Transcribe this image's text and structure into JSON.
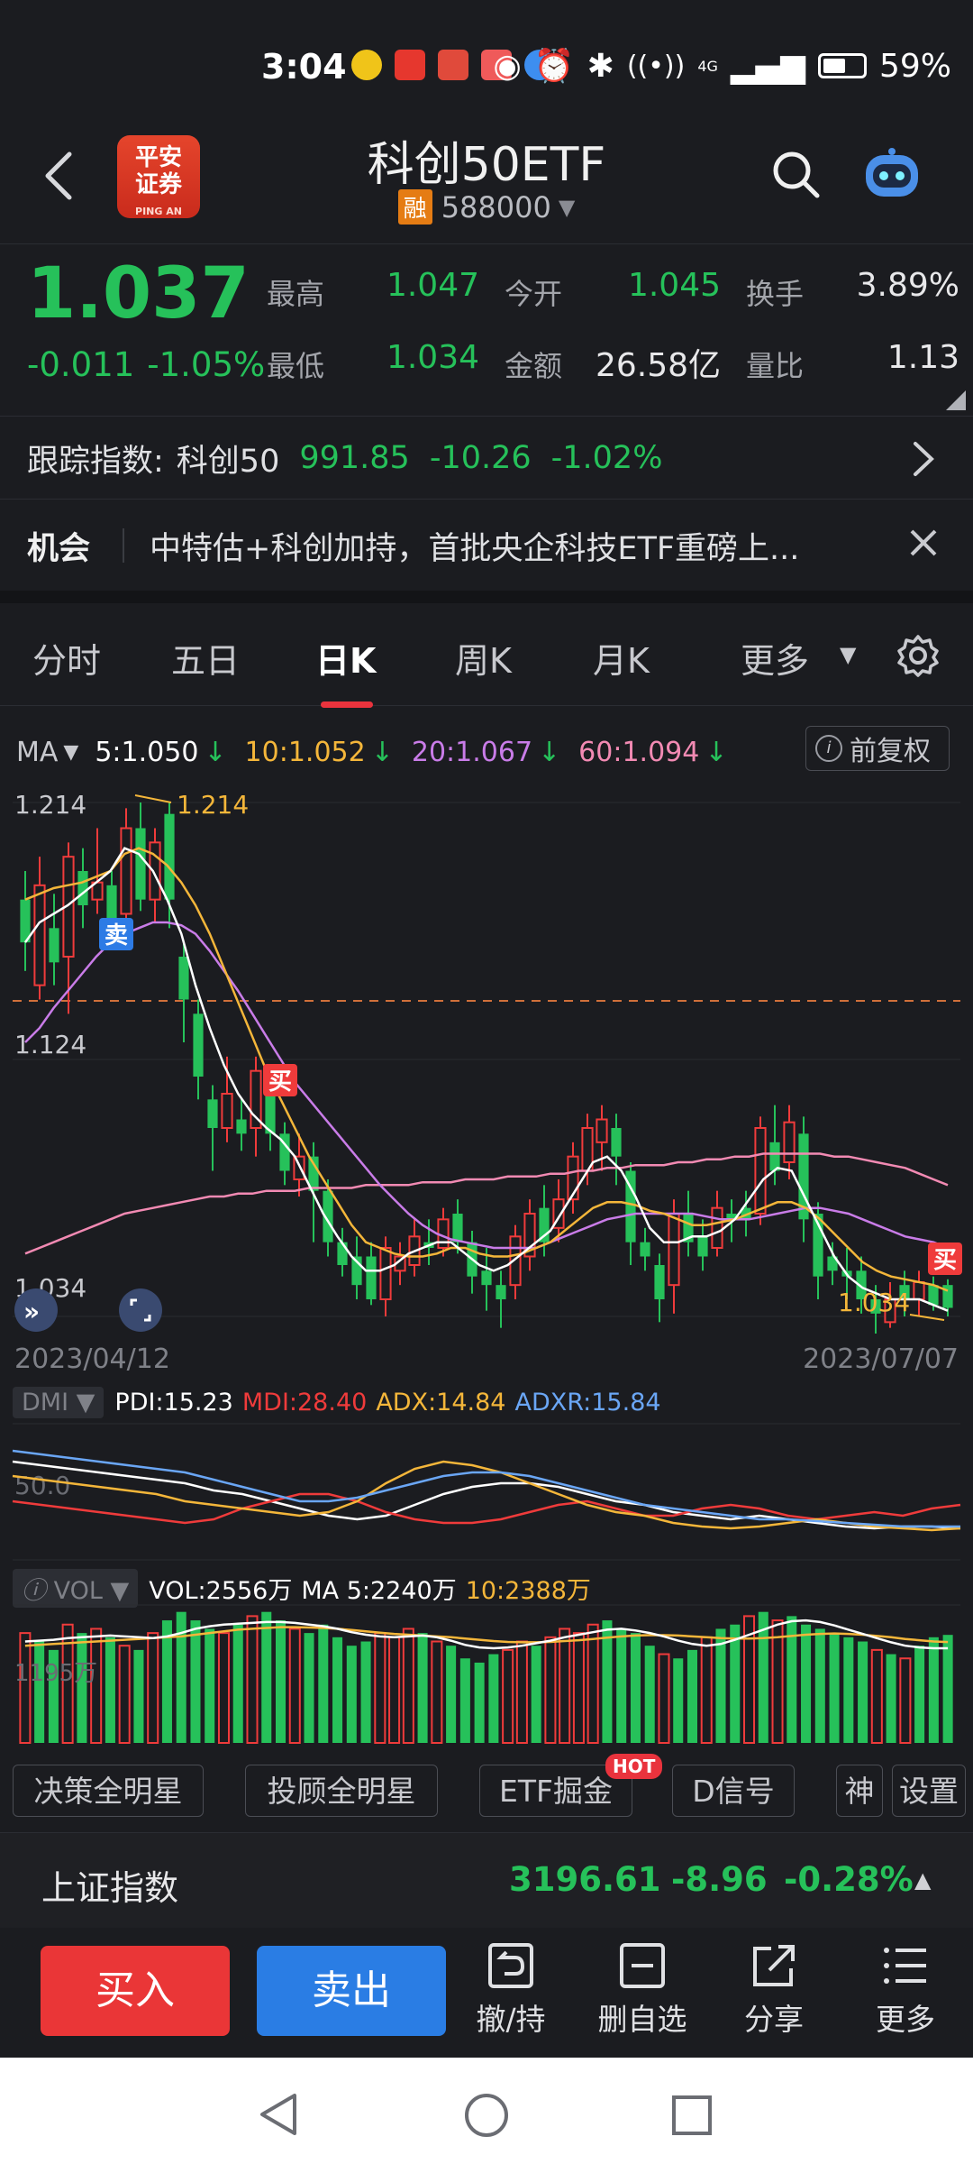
{
  "status_bar": {
    "time": "3:04",
    "battery": "59%",
    "network": "4G"
  },
  "header": {
    "title": "科创50ETF",
    "margin_badge": "融",
    "code": "588000",
    "logo_text_1": "平安",
    "logo_text_2": "证券",
    "logo_sub": "PING AN"
  },
  "quote": {
    "price": "1.037",
    "change": "-0.011",
    "change_pct": "-1.05%",
    "high_label": "最高",
    "high": "1.047",
    "open_label": "今开",
    "open": "1.045",
    "turnover_label": "换手",
    "turnover": "3.89%",
    "low_label": "最低",
    "low": "1.034",
    "amount_label": "金额",
    "amount": "26.58亿",
    "vol_ratio_label": "量比",
    "vol_ratio": "1.13"
  },
  "tracking": {
    "label": "跟踪指数:",
    "name": "科创50",
    "value": "991.85",
    "change": "-10.26",
    "pct": "-1.02%"
  },
  "news": {
    "tag": "机会",
    "text": "中特估+科创加持，首批央企科技ETF重磅上..."
  },
  "tabs": [
    "分时",
    "五日",
    "日K",
    "周K",
    "月K",
    "更多"
  ],
  "ma": {
    "label": "MA",
    "ma5": "5:1.050",
    "ma10": "10:1.052",
    "ma20": "20:1.067",
    "ma60": "60:1.094",
    "fuquan": "前复权"
  },
  "chart_labels": {
    "y_top": "1.214",
    "y_mid": "1.124",
    "y_bottom": "1.034",
    "max_mark": "1.214",
    "min_mark": "1.034",
    "sell_badge": "卖",
    "buy_badge": "买",
    "buy_badge2": "买"
  },
  "dates": {
    "start": "2023/04/12",
    "end": "2023/07/07"
  },
  "dmi": {
    "pill": "DMI",
    "pdi": "PDI:15.23",
    "mdi": "MDI:28.40",
    "adx": "ADX:14.84",
    "adxr": "ADXR:15.84",
    "axis": "50.0"
  },
  "vol": {
    "pill": "VOL",
    "vol": "VOL:2556万",
    "ma5": "MA 5:2240万",
    "ma10": "10:2388万",
    "axis": "1195万"
  },
  "chips": [
    "决策全明星",
    "投顾全明星",
    "ETF掘金",
    "D信号",
    "神",
    "设置"
  ],
  "chip_hot": "HOT",
  "index_bar": {
    "name": "上证指数",
    "value": "3196.61",
    "change": "-8.96",
    "pct": "-0.28%"
  },
  "actions": {
    "buy": "买入",
    "sell": "卖出",
    "cancel": "撤/持",
    "remove": "删自选",
    "share": "分享",
    "more": "更多"
  },
  "colors": {
    "up": "#ef3b3b",
    "down": "#26c15a",
    "ma5": "#ffffff",
    "ma10": "#f4b63a",
    "ma20": "#c97ce8",
    "ma60": "#f28ab3",
    "buy": "#ef3b3b",
    "sell": "#2d7be5"
  },
  "chart_data": [
    {
      "type": "candlestick",
      "x_range": [
        "2023/04/12",
        "2023/07/07"
      ],
      "ylim": [
        1.034,
        1.214
      ],
      "max": 1.214,
      "min": 1.034,
      "candles": [
        {
          "o": 1.18,
          "c": 1.165,
          "h": 1.19,
          "l": 1.155
        },
        {
          "o": 1.15,
          "c": 1.185,
          "h": 1.195,
          "l": 1.145
        },
        {
          "o": 1.17,
          "c": 1.158,
          "h": 1.182,
          "l": 1.15
        },
        {
          "o": 1.16,
          "c": 1.195,
          "h": 1.2,
          "l": 1.14
        },
        {
          "o": 1.19,
          "c": 1.178,
          "h": 1.198,
          "l": 1.17
        },
        {
          "o": 1.18,
          "c": 1.186,
          "h": 1.205,
          "l": 1.175
        },
        {
          "o": 1.185,
          "c": 1.172,
          "h": 1.19,
          "l": 1.165
        },
        {
          "o": 1.175,
          "c": 1.205,
          "h": 1.212,
          "l": 1.17
        },
        {
          "o": 1.205,
          "c": 1.18,
          "h": 1.214,
          "l": 1.176
        },
        {
          "o": 1.18,
          "c": 1.2,
          "h": 1.205,
          "l": 1.172
        },
        {
          "o": 1.21,
          "c": 1.18,
          "h": 1.214,
          "l": 1.17
        },
        {
          "o": 1.16,
          "c": 1.145,
          "h": 1.165,
          "l": 1.13
        },
        {
          "o": 1.14,
          "c": 1.118,
          "h": 1.145,
          "l": 1.11
        },
        {
          "o": 1.11,
          "c": 1.1,
          "h": 1.115,
          "l": 1.085
        },
        {
          "o": 1.1,
          "c": 1.112,
          "h": 1.125,
          "l": 1.095
        },
        {
          "o": 1.103,
          "c": 1.098,
          "h": 1.11,
          "l": 1.092
        },
        {
          "o": 1.1,
          "c": 1.12,
          "h": 1.125,
          "l": 1.09
        },
        {
          "o": 1.118,
          "c": 1.098,
          "h": 1.122,
          "l": 1.092
        },
        {
          "o": 1.098,
          "c": 1.085,
          "h": 1.102,
          "l": 1.08
        },
        {
          "o": 1.082,
          "c": 1.09,
          "h": 1.098,
          "l": 1.076
        },
        {
          "o": 1.09,
          "c": 1.078,
          "h": 1.095,
          "l": 1.06
        },
        {
          "o": 1.078,
          "c": 1.06,
          "h": 1.082,
          "l": 1.055
        },
        {
          "o": 1.06,
          "c": 1.052,
          "h": 1.065,
          "l": 1.048
        },
        {
          "o": 1.055,
          "c": 1.045,
          "h": 1.062,
          "l": 1.04
        },
        {
          "o": 1.055,
          "c": 1.04,
          "h": 1.06,
          "l": 1.038
        },
        {
          "o": 1.04,
          "c": 1.058,
          "h": 1.062,
          "l": 1.034
        },
        {
          "o": 1.05,
          "c": 1.055,
          "h": 1.06,
          "l": 1.045
        },
        {
          "o": 1.052,
          "c": 1.062,
          "h": 1.068,
          "l": 1.048
        },
        {
          "o": 1.06,
          "c": 1.058,
          "h": 1.068,
          "l": 1.052
        },
        {
          "o": 1.058,
          "c": 1.068,
          "h": 1.072,
          "l": 1.055
        },
        {
          "o": 1.07,
          "c": 1.06,
          "h": 1.075,
          "l": 1.056
        },
        {
          "o": 1.06,
          "c": 1.048,
          "h": 1.064,
          "l": 1.042
        },
        {
          "o": 1.05,
          "c": 1.045,
          "h": 1.058,
          "l": 1.036
        },
        {
          "o": 1.045,
          "c": 1.04,
          "h": 1.05,
          "l": 1.03
        },
        {
          "o": 1.045,
          "c": 1.062,
          "h": 1.066,
          "l": 1.04
        },
        {
          "o": 1.055,
          "c": 1.07,
          "h": 1.075,
          "l": 1.05
        },
        {
          "o": 1.072,
          "c": 1.06,
          "h": 1.08,
          "l": 1.055
        },
        {
          "o": 1.065,
          "c": 1.075,
          "h": 1.082,
          "l": 1.06
        },
        {
          "o": 1.075,
          "c": 1.09,
          "h": 1.095,
          "l": 1.07
        },
        {
          "o": 1.085,
          "c": 1.1,
          "h": 1.105,
          "l": 1.08
        },
        {
          "o": 1.095,
          "c": 1.103,
          "h": 1.108,
          "l": 1.085
        },
        {
          "o": 1.1,
          "c": 1.09,
          "h": 1.105,
          "l": 1.08
        },
        {
          "o": 1.085,
          "c": 1.06,
          "h": 1.088,
          "l": 1.052
        },
        {
          "o": 1.06,
          "c": 1.055,
          "h": 1.065,
          "l": 1.05
        },
        {
          "o": 1.052,
          "c": 1.04,
          "h": 1.056,
          "l": 1.032
        },
        {
          "o": 1.045,
          "c": 1.07,
          "h": 1.075,
          "l": 1.035
        },
        {
          "o": 1.07,
          "c": 1.06,
          "h": 1.078,
          "l": 1.055
        },
        {
          "o": 1.062,
          "c": 1.055,
          "h": 1.068,
          "l": 1.05
        },
        {
          "o": 1.058,
          "c": 1.072,
          "h": 1.078,
          "l": 1.055
        },
        {
          "o": 1.07,
          "c": 1.068,
          "h": 1.075,
          "l": 1.06
        },
        {
          "o": 1.072,
          "c": 1.068,
          "h": 1.078,
          "l": 1.062
        },
        {
          "o": 1.07,
          "c": 1.1,
          "h": 1.104,
          "l": 1.066
        },
        {
          "o": 1.095,
          "c": 1.085,
          "h": 1.108,
          "l": 1.08
        },
        {
          "o": 1.088,
          "c": 1.102,
          "h": 1.108,
          "l": 1.082
        },
        {
          "o": 1.098,
          "c": 1.068,
          "h": 1.104,
          "l": 1.06
        },
        {
          "o": 1.07,
          "c": 1.048,
          "h": 1.074,
          "l": 1.04
        },
        {
          "o": 1.055,
          "c": 1.05,
          "h": 1.06,
          "l": 1.045
        },
        {
          "o": 1.05,
          "c": 1.048,
          "h": 1.058,
          "l": 1.04
        },
        {
          "o": 1.05,
          "c": 1.04,
          "h": 1.055,
          "l": 1.035
        },
        {
          "o": 1.04,
          "c": 1.035,
          "h": 1.045,
          "l": 1.028
        },
        {
          "o": 1.032,
          "c": 1.04,
          "h": 1.046,
          "l": 1.03
        },
        {
          "o": 1.045,
          "c": 1.04,
          "h": 1.05,
          "l": 1.034
        },
        {
          "o": 1.04,
          "c": 1.046,
          "h": 1.05,
          "l": 1.034
        },
        {
          "o": 1.045,
          "c": 1.038,
          "h": 1.048,
          "l": 1.036
        },
        {
          "o": 1.045,
          "c": 1.037,
          "h": 1.047,
          "l": 1.034
        }
      ],
      "ma5": [
        1.165,
        1.172,
        1.175,
        1.178,
        1.182,
        1.186,
        1.19,
        1.198,
        1.196,
        1.19,
        1.18,
        1.168,
        1.15,
        1.135,
        1.122,
        1.112,
        1.105,
        1.1,
        1.096,
        1.09,
        1.08,
        1.07,
        1.062,
        1.055,
        1.05,
        1.05,
        1.052,
        1.056,
        1.058,
        1.06,
        1.06,
        1.056,
        1.052,
        1.05,
        1.052,
        1.056,
        1.06,
        1.064,
        1.072,
        1.08,
        1.088,
        1.09,
        1.085,
        1.076,
        1.065,
        1.06,
        1.06,
        1.062,
        1.062,
        1.064,
        1.068,
        1.075,
        1.082,
        1.086,
        1.085,
        1.075,
        1.065,
        1.055,
        1.048,
        1.044,
        1.042,
        1.04,
        1.04,
        1.04,
        1.038,
        1.036
      ],
      "ma10": [
        1.18,
        1.182,
        1.184,
        1.185,
        1.186,
        1.188,
        1.19,
        1.196,
        1.198,
        1.196,
        1.192,
        1.186,
        1.178,
        1.168,
        1.156,
        1.144,
        1.132,
        1.12,
        1.11,
        1.1,
        1.09,
        1.082,
        1.074,
        1.066,
        1.06,
        1.058,
        1.056,
        1.055,
        1.055,
        1.056,
        1.058,
        1.058,
        1.056,
        1.055,
        1.055,
        1.056,
        1.058,
        1.06,
        1.064,
        1.068,
        1.072,
        1.074,
        1.074,
        1.073,
        1.071,
        1.07,
        1.068,
        1.066,
        1.066,
        1.067,
        1.068,
        1.07,
        1.072,
        1.074,
        1.074,
        1.072,
        1.068,
        1.063,
        1.058,
        1.053,
        1.05,
        1.048,
        1.047,
        1.046,
        1.045,
        1.043
      ],
      "ma20": [
        1.13,
        1.135,
        1.142,
        1.148,
        1.154,
        1.16,
        1.165,
        1.168,
        1.17,
        1.172,
        1.172,
        1.171,
        1.168,
        1.162,
        1.155,
        1.148,
        1.14,
        1.132,
        1.124,
        1.116,
        1.11,
        1.104,
        1.098,
        1.092,
        1.086,
        1.08,
        1.075,
        1.07,
        1.066,
        1.063,
        1.061,
        1.06,
        1.059,
        1.058,
        1.058,
        1.058,
        1.058,
        1.06,
        1.062,
        1.064,
        1.066,
        1.068,
        1.069,
        1.07,
        1.07,
        1.07,
        1.07,
        1.07,
        1.069,
        1.068,
        1.068,
        1.068,
        1.069,
        1.07,
        1.071,
        1.072,
        1.072,
        1.071,
        1.07,
        1.068,
        1.066,
        1.064,
        1.062,
        1.061,
        1.06,
        1.058
      ],
      "ma60": [
        1.056,
        1.058,
        1.06,
        1.062,
        1.064,
        1.066,
        1.068,
        1.07,
        1.071,
        1.072,
        1.073,
        1.074,
        1.075,
        1.076,
        1.076,
        1.077,
        1.077,
        1.078,
        1.078,
        1.078,
        1.079,
        1.079,
        1.079,
        1.079,
        1.08,
        1.08,
        1.08,
        1.08,
        1.081,
        1.081,
        1.081,
        1.082,
        1.082,
        1.082,
        1.083,
        1.083,
        1.083,
        1.084,
        1.084,
        1.085,
        1.085,
        1.086,
        1.086,
        1.087,
        1.087,
        1.087,
        1.088,
        1.088,
        1.089,
        1.089,
        1.09,
        1.09,
        1.091,
        1.091,
        1.091,
        1.091,
        1.091,
        1.09,
        1.09,
        1.089,
        1.088,
        1.087,
        1.086,
        1.084,
        1.082,
        1.08
      ]
    },
    {
      "type": "line",
      "name": "DMI",
      "series": [
        {
          "name": "PDI",
          "values": [
            52,
            50,
            48,
            46,
            44,
            42,
            40,
            36,
            34,
            30,
            26,
            22,
            20,
            22,
            28,
            34,
            38,
            40,
            40,
            38,
            34,
            30,
            28,
            24,
            22,
            20,
            22,
            20,
            18,
            16,
            15,
            16,
            16,
            15
          ]
        },
        {
          "name": "MDI",
          "values": [
            30,
            28,
            26,
            24,
            22,
            20,
            18,
            20,
            26,
            30,
            34,
            34,
            30,
            24,
            20,
            18,
            18,
            20,
            24,
            28,
            30,
            26,
            22,
            22,
            26,
            28,
            26,
            22,
            20,
            22,
            24,
            22,
            26,
            28
          ]
        },
        {
          "name": "ADX",
          "values": [
            44,
            42,
            40,
            38,
            36,
            34,
            30,
            28,
            26,
            24,
            22,
            24,
            30,
            40,
            48,
            52,
            50,
            46,
            40,
            34,
            28,
            24,
            22,
            18,
            16,
            15,
            16,
            18,
            20,
            18,
            16,
            15,
            14,
            15
          ]
        },
        {
          "name": "ADXR",
          "values": [
            58,
            56,
            54,
            52,
            50,
            48,
            46,
            42,
            38,
            34,
            30,
            30,
            32,
            36,
            40,
            44,
            46,
            46,
            44,
            40,
            36,
            32,
            28,
            26,
            24,
            22,
            20,
            20,
            19,
            18,
            17,
            16,
            16,
            16
          ]
        }
      ]
    },
    {
      "type": "bar",
      "name": "VOL",
      "values": [
        2600,
        2400,
        2200,
        2800,
        2600,
        2700,
        2500,
        2300,
        2200,
        2600,
        2900,
        3100,
        2900,
        2700,
        2600,
        2800,
        3000,
        3100,
        2900,
        2700,
        2600,
        2800,
        2500,
        2300,
        2400,
        2600,
        2500,
        2700,
        2600,
        2400,
        2300,
        2000,
        1900,
        2100,
        2200,
        2400,
        2300,
        2500,
        2700,
        2600,
        2800,
        2900,
        2700,
        2600,
        2300,
        2100,
        2000,
        2200,
        2500,
        2700,
        2800,
        3000,
        3100,
        2900,
        3000,
        2800,
        2700,
        2600,
        2500,
        2400,
        2200,
        2100,
        2000,
        2300,
        2500,
        2556
      ],
      "up": [
        true,
        false,
        false,
        true,
        false,
        true,
        false,
        true,
        false,
        true,
        false,
        false,
        false,
        false,
        true,
        false,
        true,
        false,
        false,
        true,
        false,
        false,
        false,
        false,
        false,
        true,
        true,
        true,
        false,
        true,
        false,
        false,
        false,
        false,
        true,
        true,
        false,
        true,
        true,
        true,
        true,
        false,
        false,
        false,
        false,
        true,
        false,
        false,
        true,
        false,
        false,
        true,
        false,
        true,
        false,
        false,
        false,
        false,
        false,
        false,
        true,
        false,
        true,
        false,
        false,
        false
      ],
      "ma5": [
        2400,
        2420,
        2440,
        2480,
        2500,
        2520,
        2540,
        2520,
        2500,
        2480,
        2520,
        2600,
        2700,
        2760,
        2800,
        2820,
        2840,
        2860,
        2860,
        2840,
        2800,
        2760,
        2700,
        2620,
        2560,
        2520,
        2500,
        2520,
        2540,
        2500,
        2420,
        2320,
        2260,
        2240,
        2260,
        2300,
        2360,
        2420,
        2500,
        2560,
        2620,
        2680,
        2700,
        2660,
        2600,
        2520,
        2420,
        2340,
        2300,
        2340,
        2440,
        2560,
        2680,
        2800,
        2880,
        2900,
        2860,
        2780,
        2680,
        2580,
        2480,
        2380,
        2300,
        2260,
        2240,
        2240
      ],
      "ma10": [
        2300,
        2320,
        2340,
        2360,
        2380,
        2400,
        2420,
        2440,
        2460,
        2480,
        2500,
        2520,
        2560,
        2600,
        2640,
        2680,
        2700,
        2720,
        2740,
        2740,
        2730,
        2720,
        2700,
        2670,
        2640,
        2610,
        2580,
        2560,
        2540,
        2520,
        2500,
        2470,
        2440,
        2410,
        2390,
        2380,
        2380,
        2390,
        2410,
        2430,
        2460,
        2490,
        2520,
        2540,
        2550,
        2550,
        2540,
        2520,
        2500,
        2480,
        2470,
        2470,
        2480,
        2500,
        2530,
        2560,
        2580,
        2590,
        2580,
        2560,
        2530,
        2500,
        2460,
        2430,
        2400,
        2388
      ]
    }
  ]
}
